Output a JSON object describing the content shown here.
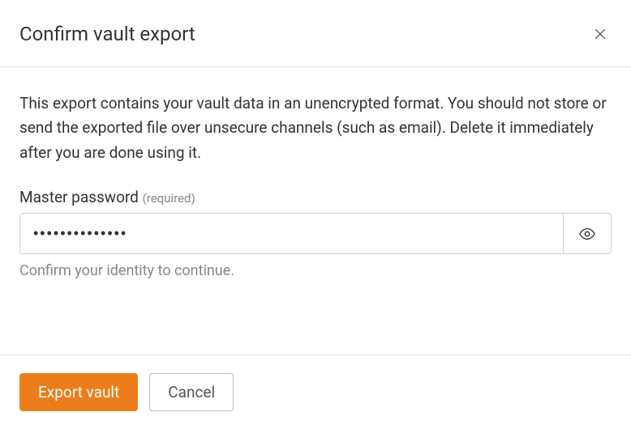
{
  "dialog": {
    "title": "Confirm vault export",
    "description": "This export contains your vault data in an unencrypted format. You should not store or send the exported file over unsecure channels (such as email). Delete it immediately after you are done using it.",
    "field": {
      "label": "Master password",
      "required_hint": "(required)",
      "value": "••••••••••••••",
      "helper": "Confirm your identity to continue."
    },
    "buttons": {
      "primary": "Export vault",
      "secondary": "Cancel"
    }
  }
}
